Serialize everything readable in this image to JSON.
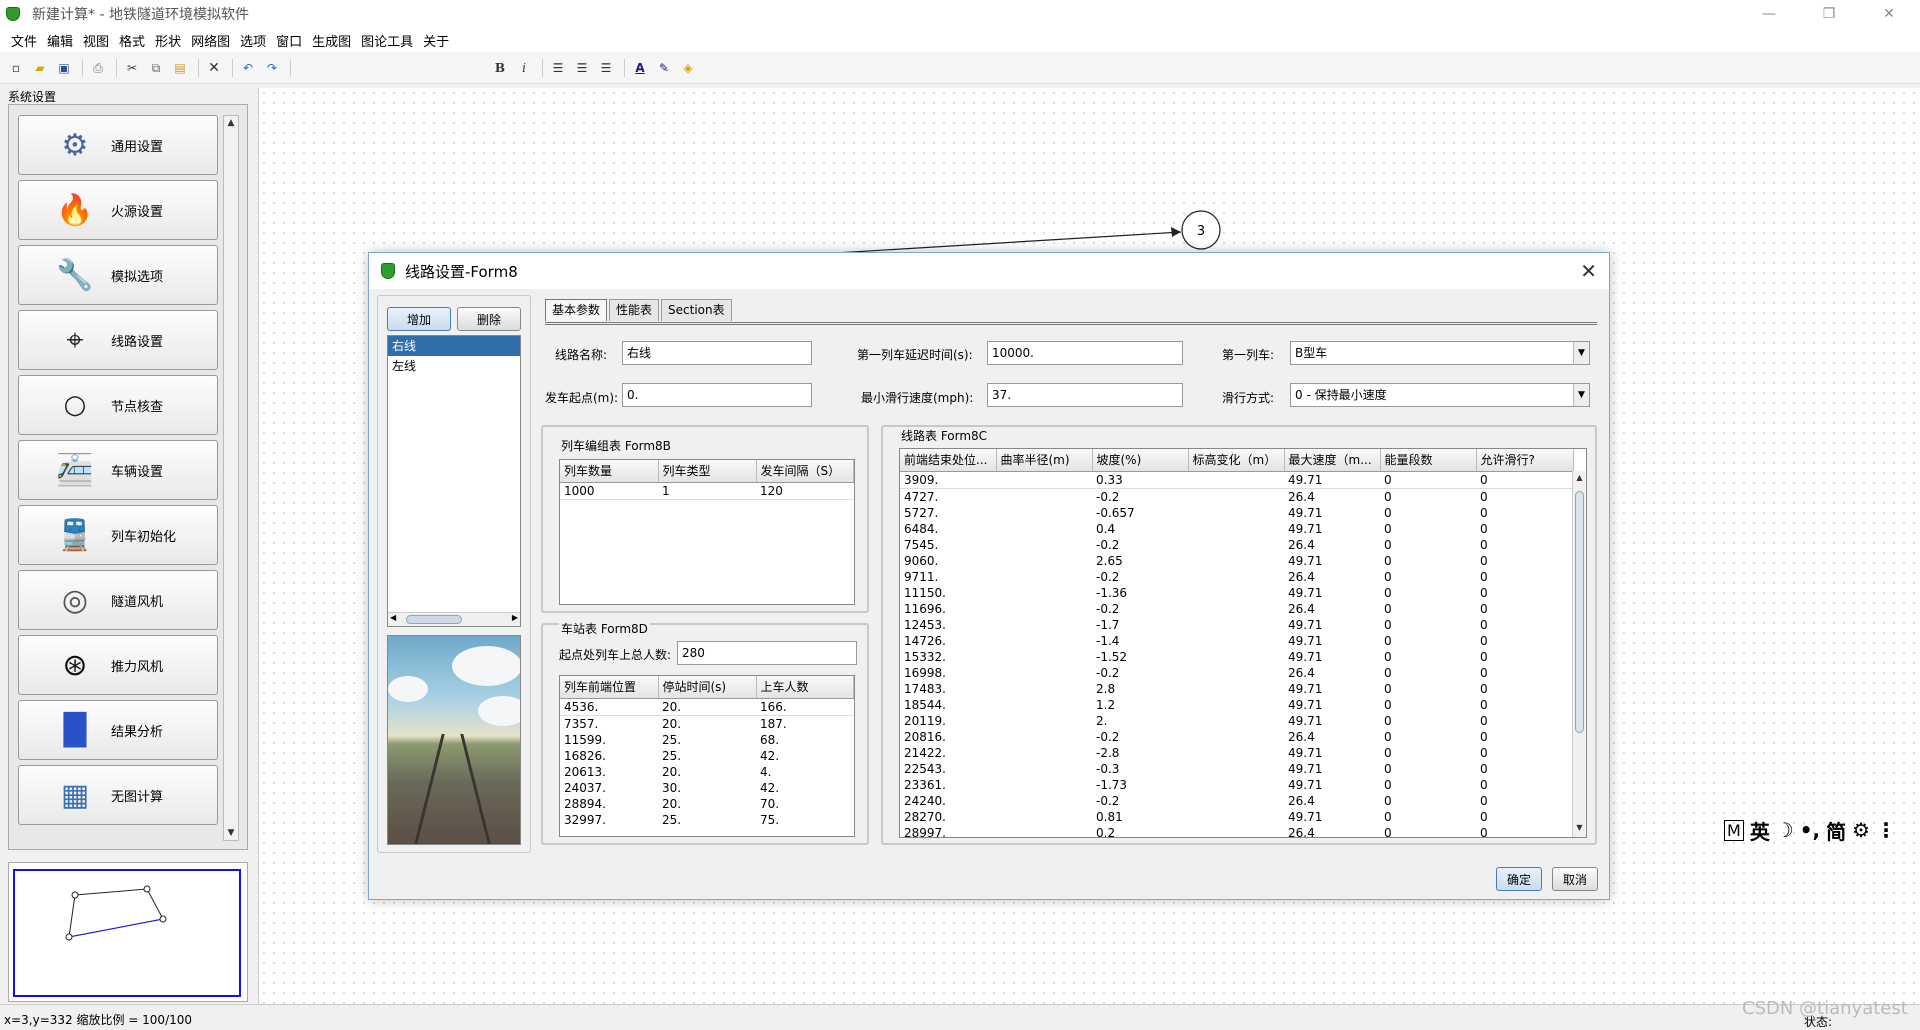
{
  "window": {
    "title": "新建计算* - 地铁隧道环境模拟软件",
    "minimize": "—",
    "maximize": "❐",
    "close": "✕"
  },
  "menu": [
    "文件",
    "编辑",
    "视图",
    "格式",
    "形状",
    "网络图",
    "选项",
    "窗口",
    "生成图",
    "图论工具",
    "关于"
  ],
  "toolbar": {
    "icons": [
      "new-file-icon",
      "open-folder-icon",
      "save-icon",
      "print-icon",
      "cut-icon",
      "copy-icon",
      "paste-icon",
      "delete-icon",
      "undo-icon",
      "redo-icon",
      "bold-icon",
      "italic-icon",
      "align-left-icon",
      "align-center-icon",
      "align-right-icon",
      "font-color-icon",
      "line-color-icon",
      "fill-color-icon"
    ],
    "bold": "B",
    "italic": "i",
    "font_color": "A"
  },
  "sidebar": {
    "title": "系统设置",
    "items": [
      {
        "label": "通用设置",
        "icon": "gear-icon"
      },
      {
        "label": "火源设置",
        "icon": "fire-icon"
      },
      {
        "label": "模拟选项",
        "icon": "wrench-icon"
      },
      {
        "label": "线路设置",
        "icon": "route-icon"
      },
      {
        "label": "节点核查",
        "icon": "node-circle-icon"
      },
      {
        "label": "车辆设置",
        "icon": "vehicle-settings-icon"
      },
      {
        "label": "列车初始化",
        "icon": "train-icon"
      },
      {
        "label": "隧道风机",
        "icon": "tunnel-fan-icon"
      },
      {
        "label": "推力风机",
        "icon": "jet-fan-icon"
      },
      {
        "label": "结果分析",
        "icon": "bar-chart-icon"
      },
      {
        "label": "无图计算",
        "icon": "calculator-icon"
      }
    ]
  },
  "canvas": {
    "node_label": "3"
  },
  "status": {
    "coord": "x=3,y=332   缩放比例 = 100/100",
    "state": "状态:"
  },
  "watermark": "CSDN @tianyatest",
  "ime": {
    "mode": "M",
    "lang": "英",
    "moon": "☽",
    "punct": "•,",
    "simplified": "简",
    "settings": "⚙",
    "more": "⋮"
  },
  "dialog": {
    "title": "线路设置-Form8",
    "add": "增加",
    "delete": "删除",
    "lines": [
      "右线",
      "左线"
    ],
    "tabs": [
      "基本参数",
      "性能表",
      "Section表"
    ],
    "fields": {
      "line_name_label": "线路名称:",
      "line_name": "右线",
      "first_delay_label": "第一列车延迟时间(s):",
      "first_delay": "10000.",
      "first_train_label": "第一列车:",
      "first_train": "B型车",
      "start_label": "发车起点(m):",
      "start": "0.",
      "min_speed_label": "最小滑行速度(mph):",
      "min_speed": "37.",
      "coast_label": "滑行方式:",
      "coast": "0 - 保持最小速度"
    },
    "consist": {
      "title": "列车编组表 Form8B",
      "headers": [
        "列车数量",
        "列车类型",
        "发车间隔（S）"
      ],
      "rows": [
        [
          "1000",
          "1",
          "120"
        ]
      ]
    },
    "station": {
      "title": "车站表 Form8D",
      "pax_label": "起点处列车上总人数:",
      "pax": "280",
      "headers": [
        "列车前端位置",
        "停站时间(s)",
        "上车人数"
      ],
      "rows": [
        [
          "4536.",
          "20.",
          "166."
        ],
        [
          "7357.",
          "20.",
          "187."
        ],
        [
          "11599.",
          "25.",
          "68."
        ],
        [
          "16826.",
          "25.",
          "42."
        ],
        [
          "20613.",
          "20.",
          "4."
        ],
        [
          "24037.",
          "30.",
          "42."
        ],
        [
          "28894.",
          "20.",
          "70."
        ],
        [
          "32997.",
          "25.",
          "75."
        ]
      ]
    },
    "route": {
      "title": "线路表 Form8C",
      "headers": [
        "前端结束处位...",
        "曲率半径(m)",
        "坡度(%)",
        "标高变化（m）",
        "最大速度（m...",
        "能量段数",
        "允许滑行?"
      ],
      "rows": [
        [
          "3909.",
          "",
          "0.33",
          "",
          "49.71",
          "0",
          "0"
        ],
        [
          "4727.",
          "",
          "-0.2",
          "",
          "26.4",
          "0",
          "0"
        ],
        [
          "5727.",
          "",
          "-0.657",
          "",
          "49.71",
          "0",
          "0"
        ],
        [
          "6484.",
          "",
          "0.4",
          "",
          "49.71",
          "0",
          "0"
        ],
        [
          "7545.",
          "",
          "-0.2",
          "",
          "26.4",
          "0",
          "0"
        ],
        [
          "9060.",
          "",
          "2.65",
          "",
          "49.71",
          "0",
          "0"
        ],
        [
          "9711.",
          "",
          "-0.2",
          "",
          "26.4",
          "0",
          "0"
        ],
        [
          "11150.",
          "",
          "-1.36",
          "",
          "49.71",
          "0",
          "0"
        ],
        [
          "11696.",
          "",
          "-0.2",
          "",
          "26.4",
          "0",
          "0"
        ],
        [
          "12453.",
          "",
          "-1.7",
          "",
          "49.71",
          "0",
          "0"
        ],
        [
          "14726.",
          "",
          "-1.4",
          "",
          "49.71",
          "0",
          "0"
        ],
        [
          "15332.",
          "",
          "-1.52",
          "",
          "49.71",
          "0",
          "0"
        ],
        [
          "16998.",
          "",
          "-0.2",
          "",
          "26.4",
          "0",
          "0"
        ],
        [
          "17483.",
          "",
          "2.8",
          "",
          "49.71",
          "0",
          "0"
        ],
        [
          "18544.",
          "",
          "1.2",
          "",
          "49.71",
          "0",
          "0"
        ],
        [
          "20119.",
          "",
          "2.",
          "",
          "49.71",
          "0",
          "0"
        ],
        [
          "20816.",
          "",
          "-0.2",
          "",
          "26.4",
          "0",
          "0"
        ],
        [
          "21422.",
          "",
          "-2.8",
          "",
          "49.71",
          "0",
          "0"
        ],
        [
          "22543.",
          "",
          "-0.3",
          "",
          "49.71",
          "0",
          "0"
        ],
        [
          "23361.",
          "",
          "-1.73",
          "",
          "49.71",
          "0",
          "0"
        ],
        [
          "24240.",
          "",
          "-0.2",
          "",
          "26.4",
          "0",
          "0"
        ],
        [
          "28270.",
          "",
          "0.81",
          "",
          "49.71",
          "0",
          "0"
        ],
        [
          "28997.",
          "",
          "0.2",
          "",
          "26.4",
          "0",
          "0"
        ]
      ]
    },
    "ok": "确定",
    "cancel": "取消"
  },
  "colors": {
    "selection": "#2f6eab",
    "dialog_border": "#7aa6d8",
    "app_icon": "#2e9d2e"
  }
}
